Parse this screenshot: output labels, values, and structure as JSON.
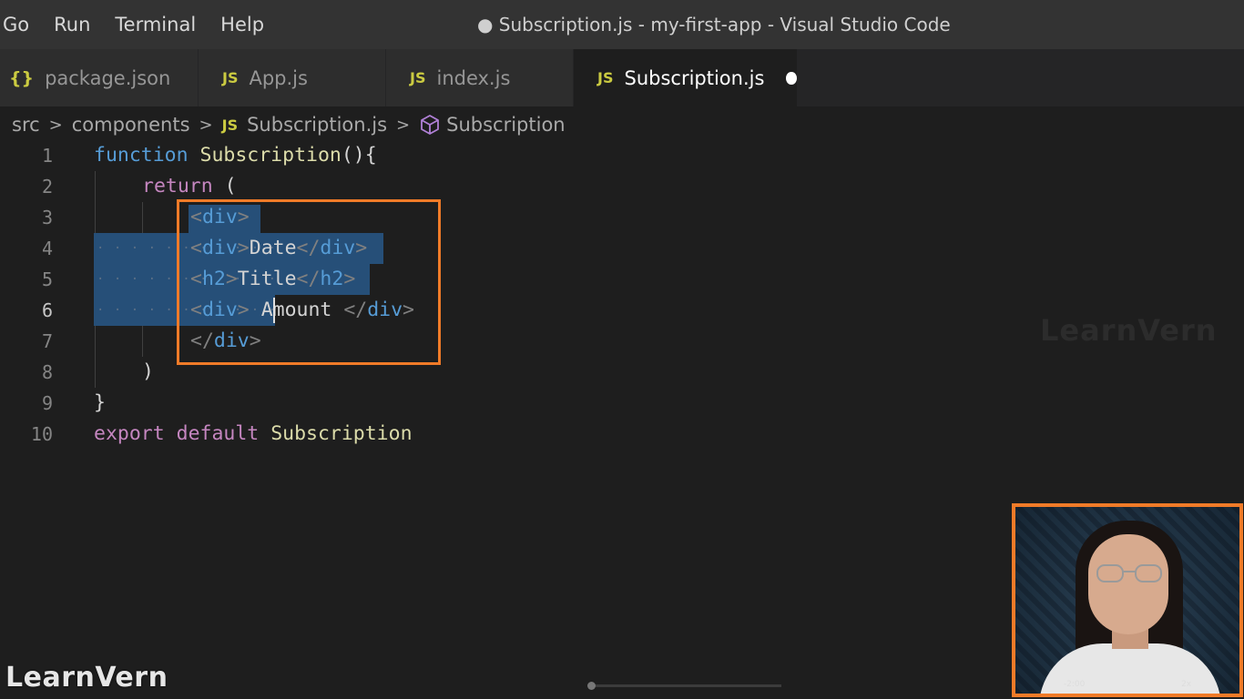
{
  "menu": [
    "Go",
    "Run",
    "Terminal",
    "Help"
  ],
  "window_title": "● Subscription.js - my-first-app - Visual Studio Code",
  "tabs": [
    {
      "icon": "{}",
      "label": "package.json"
    },
    {
      "icon": "JS",
      "label": "App.js"
    },
    {
      "icon": "JS",
      "label": "index.js"
    },
    {
      "icon": "JS",
      "label": "Subscription.js"
    }
  ],
  "breadcrumb": {
    "folder1": "src",
    "folder2": "components",
    "file_icon": "JS",
    "file": "Subscription.js",
    "symbol": "Subscription"
  },
  "line_numbers": [
    "1",
    "2",
    "3",
    "4",
    "5",
    "6",
    "7",
    "8",
    "9",
    "10"
  ],
  "code": {
    "l1_kw": "function",
    "l1_fn": "Subscription",
    "l1_rest": "(){",
    "l2_kw": "return",
    "l2_rest": " (",
    "div": "div",
    "h2": "h2",
    "l4_text": "Date",
    "l5_text": "Title",
    "l6_text": " Amount ",
    "l8": ")",
    "l9": "}",
    "l10_kw1": "export",
    "l10_kw2": "default",
    "l10_id": "Subscription"
  },
  "watermark": "LearnVern",
  "webcam_controls": [
    "-2:00",
    "2x"
  ],
  "colors": {
    "accent_orange": "#f07b28",
    "selection": "#264f78",
    "keyword_blue": "#569cd6",
    "keyword_purple": "#c586c0"
  }
}
